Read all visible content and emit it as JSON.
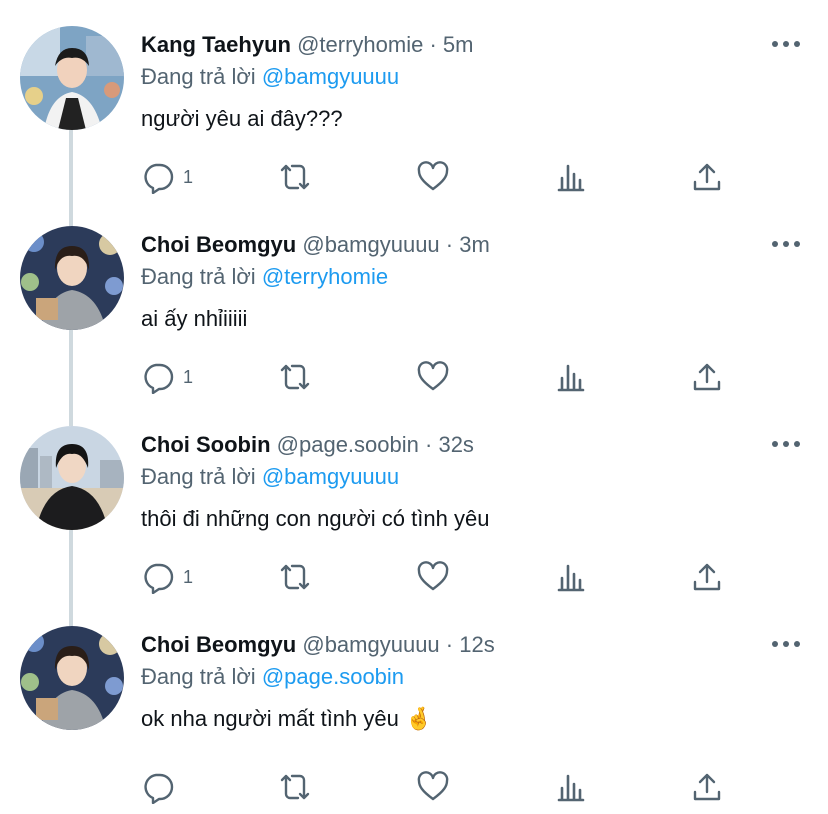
{
  "tweets": [
    {
      "name": "Kang Taehyun",
      "handle": "@terryhomie",
      "dot": "·",
      "time": "5m",
      "reply_prefix": "Đang trả lời",
      "reply_to": "@bamgyuuuu",
      "text": "người yêu ai đây???",
      "reply_count": "1"
    },
    {
      "name": "Choi Beomgyu",
      "handle": "@bamgyuuuu",
      "dot": "·",
      "time": "3m",
      "reply_prefix": "Đang trả lời",
      "reply_to": "@terryhomie",
      "text": "ai ấy nhỉiiiii",
      "reply_count": "1"
    },
    {
      "name": "Choi Soobin",
      "handle": "@page.soobin",
      "dot": "·",
      "time": "32s",
      "reply_prefix": "Đang trả lời",
      "reply_to": "@bamgyuuuu",
      "text": "thôi đi những con người có tình yêu",
      "reply_count": "1"
    },
    {
      "name": "Choi Beomgyu",
      "handle": "@bamgyuuuu",
      "dot": "·",
      "time": "12s",
      "reply_prefix": "Đang trả lời",
      "reply_to": "@page.soobin",
      "text": "ok nha người mất tình yêu 🤞",
      "reply_count": ""
    }
  ],
  "colors": {
    "accent": "#1d9bf0",
    "secondary_text": "#536471",
    "primary_text": "#0f1419",
    "thread_line": "#cfd9de"
  },
  "icons": [
    "reply-icon",
    "retweet-icon",
    "like-icon",
    "analytics-icon",
    "share-icon",
    "more-icon"
  ]
}
